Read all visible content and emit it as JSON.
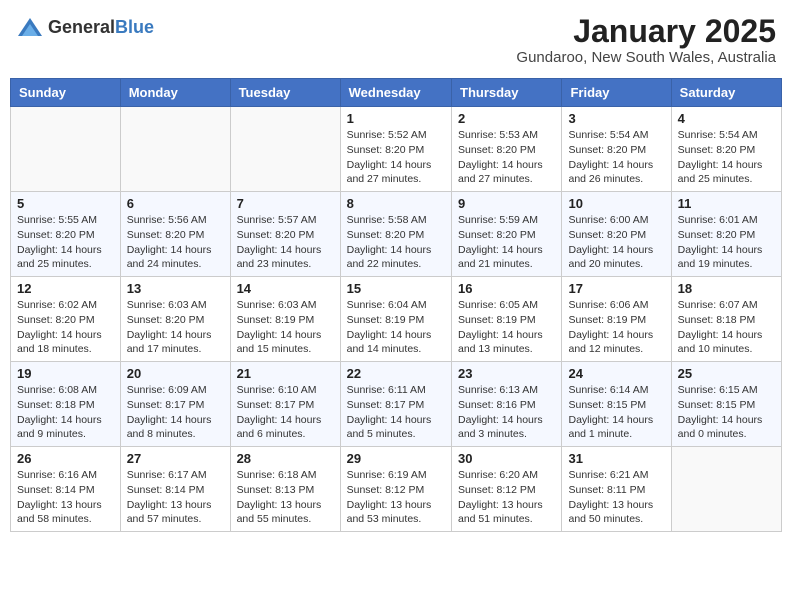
{
  "header": {
    "logo_general": "General",
    "logo_blue": "Blue",
    "title": "January 2025",
    "location": "Gundaroo, New South Wales, Australia"
  },
  "weekdays": [
    "Sunday",
    "Monday",
    "Tuesday",
    "Wednesday",
    "Thursday",
    "Friday",
    "Saturday"
  ],
  "weeks": [
    [
      null,
      null,
      null,
      {
        "day": "1",
        "sunrise": "5:52 AM",
        "sunset": "8:20 PM",
        "daylight": "14 hours and 27 minutes."
      },
      {
        "day": "2",
        "sunrise": "5:53 AM",
        "sunset": "8:20 PM",
        "daylight": "14 hours and 27 minutes."
      },
      {
        "day": "3",
        "sunrise": "5:54 AM",
        "sunset": "8:20 PM",
        "daylight": "14 hours and 26 minutes."
      },
      {
        "day": "4",
        "sunrise": "5:54 AM",
        "sunset": "8:20 PM",
        "daylight": "14 hours and 25 minutes."
      }
    ],
    [
      {
        "day": "5",
        "sunrise": "5:55 AM",
        "sunset": "8:20 PM",
        "daylight": "14 hours and 25 minutes."
      },
      {
        "day": "6",
        "sunrise": "5:56 AM",
        "sunset": "8:20 PM",
        "daylight": "14 hours and 24 minutes."
      },
      {
        "day": "7",
        "sunrise": "5:57 AM",
        "sunset": "8:20 PM",
        "daylight": "14 hours and 23 minutes."
      },
      {
        "day": "8",
        "sunrise": "5:58 AM",
        "sunset": "8:20 PM",
        "daylight": "14 hours and 22 minutes."
      },
      {
        "day": "9",
        "sunrise": "5:59 AM",
        "sunset": "8:20 PM",
        "daylight": "14 hours and 21 minutes."
      },
      {
        "day": "10",
        "sunrise": "6:00 AM",
        "sunset": "8:20 PM",
        "daylight": "14 hours and 20 minutes."
      },
      {
        "day": "11",
        "sunrise": "6:01 AM",
        "sunset": "8:20 PM",
        "daylight": "14 hours and 19 minutes."
      }
    ],
    [
      {
        "day": "12",
        "sunrise": "6:02 AM",
        "sunset": "8:20 PM",
        "daylight": "14 hours and 18 minutes."
      },
      {
        "day": "13",
        "sunrise": "6:03 AM",
        "sunset": "8:20 PM",
        "daylight": "14 hours and 17 minutes."
      },
      {
        "day": "14",
        "sunrise": "6:03 AM",
        "sunset": "8:19 PM",
        "daylight": "14 hours and 15 minutes."
      },
      {
        "day": "15",
        "sunrise": "6:04 AM",
        "sunset": "8:19 PM",
        "daylight": "14 hours and 14 minutes."
      },
      {
        "day": "16",
        "sunrise": "6:05 AM",
        "sunset": "8:19 PM",
        "daylight": "14 hours and 13 minutes."
      },
      {
        "day": "17",
        "sunrise": "6:06 AM",
        "sunset": "8:19 PM",
        "daylight": "14 hours and 12 minutes."
      },
      {
        "day": "18",
        "sunrise": "6:07 AM",
        "sunset": "8:18 PM",
        "daylight": "14 hours and 10 minutes."
      }
    ],
    [
      {
        "day": "19",
        "sunrise": "6:08 AM",
        "sunset": "8:18 PM",
        "daylight": "14 hours and 9 minutes."
      },
      {
        "day": "20",
        "sunrise": "6:09 AM",
        "sunset": "8:17 PM",
        "daylight": "14 hours and 8 minutes."
      },
      {
        "day": "21",
        "sunrise": "6:10 AM",
        "sunset": "8:17 PM",
        "daylight": "14 hours and 6 minutes."
      },
      {
        "day": "22",
        "sunrise": "6:11 AM",
        "sunset": "8:17 PM",
        "daylight": "14 hours and 5 minutes."
      },
      {
        "day": "23",
        "sunrise": "6:13 AM",
        "sunset": "8:16 PM",
        "daylight": "14 hours and 3 minutes."
      },
      {
        "day": "24",
        "sunrise": "6:14 AM",
        "sunset": "8:15 PM",
        "daylight": "14 hours and 1 minute."
      },
      {
        "day": "25",
        "sunrise": "6:15 AM",
        "sunset": "8:15 PM",
        "daylight": "14 hours and 0 minutes."
      }
    ],
    [
      {
        "day": "26",
        "sunrise": "6:16 AM",
        "sunset": "8:14 PM",
        "daylight": "13 hours and 58 minutes."
      },
      {
        "day": "27",
        "sunrise": "6:17 AM",
        "sunset": "8:14 PM",
        "daylight": "13 hours and 57 minutes."
      },
      {
        "day": "28",
        "sunrise": "6:18 AM",
        "sunset": "8:13 PM",
        "daylight": "13 hours and 55 minutes."
      },
      {
        "day": "29",
        "sunrise": "6:19 AM",
        "sunset": "8:12 PM",
        "daylight": "13 hours and 53 minutes."
      },
      {
        "day": "30",
        "sunrise": "6:20 AM",
        "sunset": "8:12 PM",
        "daylight": "13 hours and 51 minutes."
      },
      {
        "day": "31",
        "sunrise": "6:21 AM",
        "sunset": "8:11 PM",
        "daylight": "13 hours and 50 minutes."
      },
      null
    ]
  ]
}
